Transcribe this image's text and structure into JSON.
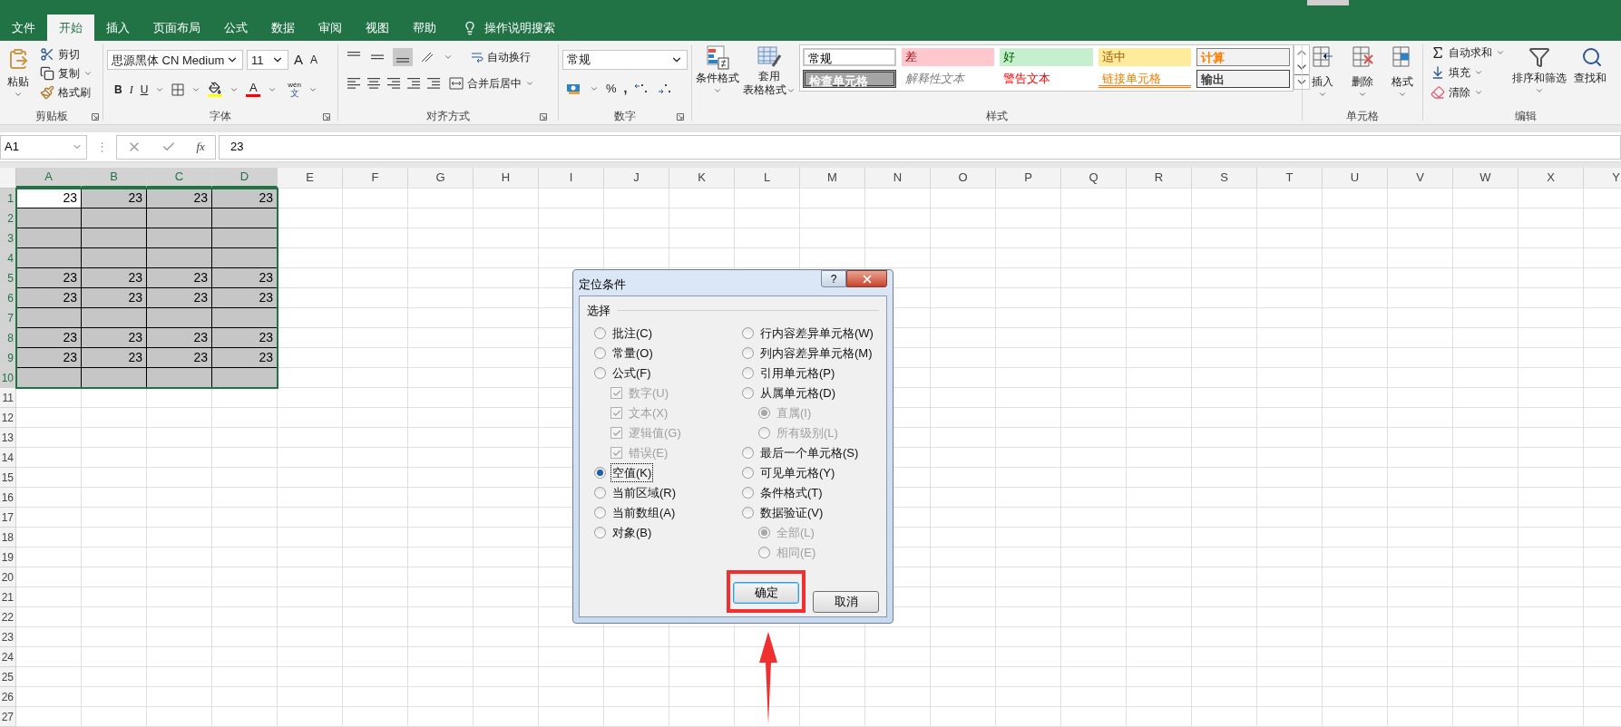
{
  "tabs": [
    {
      "label": "文件",
      "selected": false
    },
    {
      "label": "开始",
      "selected": true
    },
    {
      "label": "插入",
      "selected": false
    },
    {
      "label": "页面布局",
      "selected": false
    },
    {
      "label": "公式",
      "selected": false
    },
    {
      "label": "数据",
      "selected": false
    },
    {
      "label": "审阅",
      "selected": false
    },
    {
      "label": "视图",
      "selected": false
    },
    {
      "label": "帮助",
      "selected": false
    }
  ],
  "tell_me": "操作说明搜索",
  "clipboard": {
    "paste": "粘贴",
    "cut": "剪切",
    "copy": "复制",
    "format_painter": "格式刷",
    "label": "剪贴板"
  },
  "font": {
    "name": "思源黑体 CN Medium",
    "size": "11",
    "grow": "A",
    "shrink": "A",
    "bold": "B",
    "italic": "I",
    "underline": "U",
    "color_glyph": "A",
    "phonetic_top": "wén",
    "phonetic_bottom": "文",
    "label": "字体"
  },
  "alignment": {
    "wrap": "自动换行",
    "merge": "合并后居中",
    "label": "对齐方式"
  },
  "number": {
    "format": "常规",
    "percent": "%",
    "comma": ",",
    "label": "数字"
  },
  "styles": {
    "conditional": "条件格式",
    "table_top": "套用",
    "table_bottom": "表格格式",
    "label": "样式",
    "cells": [
      {
        "label": "常规",
        "kind": "normal"
      },
      {
        "label": "差",
        "kind": "bad"
      },
      {
        "label": "好",
        "kind": "good"
      },
      {
        "label": "适中",
        "kind": "neutral"
      },
      {
        "label": "计算",
        "kind": "calculation"
      },
      {
        "label": "检查单元格",
        "kind": "check"
      },
      {
        "label": "解释性文本",
        "kind": "explanatory"
      },
      {
        "label": "警告文本",
        "kind": "warning"
      },
      {
        "label": "链接单元格",
        "kind": "linked"
      },
      {
        "label": "输出",
        "kind": "output"
      }
    ]
  },
  "cells_group": {
    "insert": "插入",
    "delete": "删除",
    "format": "格式",
    "label": "单元格"
  },
  "editing": {
    "autosum": "自动求和",
    "fill": "填充",
    "clear": "清除",
    "sort": "排序和筛选",
    "find": "查找和",
    "label": "编辑"
  },
  "formula_bar": {
    "name_box": "A1",
    "grip": "⋮",
    "fx": "fx",
    "value": "23"
  },
  "columns": [
    {
      "label": "A",
      "selected": true
    },
    {
      "label": "B",
      "selected": true
    },
    {
      "label": "C",
      "selected": true
    },
    {
      "label": "D",
      "selected": true
    },
    {
      "label": "E",
      "selected": false
    },
    {
      "label": "F",
      "selected": false
    },
    {
      "label": "G",
      "selected": false
    },
    {
      "label": "H",
      "selected": false
    },
    {
      "label": "I",
      "selected": false
    },
    {
      "label": "J",
      "selected": false
    },
    {
      "label": "K",
      "selected": false
    },
    {
      "label": "L",
      "selected": false
    },
    {
      "label": "M",
      "selected": false
    },
    {
      "label": "N",
      "selected": false
    },
    {
      "label": "O",
      "selected": false
    },
    {
      "label": "P",
      "selected": false
    },
    {
      "label": "Q",
      "selected": false
    },
    {
      "label": "R",
      "selected": false
    },
    {
      "label": "S",
      "selected": false
    },
    {
      "label": "T",
      "selected": false
    },
    {
      "label": "U",
      "selected": false
    },
    {
      "label": "V",
      "selected": false
    },
    {
      "label": "W",
      "selected": false
    },
    {
      "label": "X",
      "selected": false
    },
    {
      "label": "Y",
      "selected": false
    }
  ],
  "rows": [
    {
      "label": "1",
      "selected": true,
      "cells": [
        {
          "value": "23",
          "selected": false
        },
        {
          "value": "23",
          "selected": true
        },
        {
          "value": "23",
          "selected": true
        },
        {
          "value": "23",
          "selected": true
        }
      ]
    },
    {
      "label": "2",
      "selected": true,
      "cells": [
        {
          "selected": true
        },
        {
          "selected": true
        },
        {
          "selected": true
        },
        {
          "selected": true
        }
      ]
    },
    {
      "label": "3",
      "selected": true,
      "cells": [
        {
          "selected": true
        },
        {
          "selected": true
        },
        {
          "selected": true
        },
        {
          "selected": true
        }
      ]
    },
    {
      "label": "4",
      "selected": true,
      "cells": [
        {
          "selected": true
        },
        {
          "selected": true
        },
        {
          "selected": true
        },
        {
          "selected": true
        }
      ]
    },
    {
      "label": "5",
      "selected": true,
      "cells": [
        {
          "value": "23",
          "selected": true
        },
        {
          "value": "23",
          "selected": true
        },
        {
          "value": "23",
          "selected": true
        },
        {
          "value": "23",
          "selected": true
        }
      ]
    },
    {
      "label": "6",
      "selected": true,
      "cells": [
        {
          "value": "23",
          "selected": true
        },
        {
          "value": "23",
          "selected": true
        },
        {
          "value": "23",
          "selected": true
        },
        {
          "value": "23",
          "selected": true
        }
      ]
    },
    {
      "label": "7",
      "selected": true,
      "cells": [
        {
          "selected": true
        },
        {
          "selected": true
        },
        {
          "selected": true
        },
        {
          "selected": true
        }
      ]
    },
    {
      "label": "8",
      "selected": true,
      "cells": [
        {
          "value": "23",
          "selected": true
        },
        {
          "value": "23",
          "selected": true
        },
        {
          "value": "23",
          "selected": true
        },
        {
          "value": "23",
          "selected": true
        }
      ]
    },
    {
      "label": "9",
      "selected": true,
      "cells": [
        {
          "value": "23",
          "selected": true
        },
        {
          "value": "23",
          "selected": true
        },
        {
          "value": "23",
          "selected": true
        },
        {
          "value": "23",
          "selected": true
        }
      ]
    },
    {
      "label": "10",
      "selected": true,
      "cells": [
        {
          "selected": true
        },
        {
          "selected": true
        },
        {
          "selected": true
        },
        {
          "selected": true
        }
      ]
    },
    {
      "label": "11",
      "selected": false
    },
    {
      "label": "12",
      "selected": false
    },
    {
      "label": "13",
      "selected": false
    },
    {
      "label": "14",
      "selected": false
    },
    {
      "label": "15",
      "selected": false
    },
    {
      "label": "16",
      "selected": false
    },
    {
      "label": "17",
      "selected": false
    },
    {
      "label": "18",
      "selected": false
    },
    {
      "label": "19",
      "selected": false
    },
    {
      "label": "20",
      "selected": false
    },
    {
      "label": "21",
      "selected": false
    },
    {
      "label": "22",
      "selected": false
    },
    {
      "label": "23",
      "selected": false
    },
    {
      "label": "24",
      "selected": false
    },
    {
      "label": "25",
      "selected": false
    },
    {
      "label": "26",
      "selected": false
    },
    {
      "label": "27",
      "selected": false
    }
  ],
  "dialog": {
    "title": "定位条件",
    "help": "?",
    "group": "选择",
    "columns": [
      {
        "options": [
          {
            "kind": "radio",
            "label": "批注(C)",
            "selected": false,
            "disabled": false
          },
          {
            "kind": "radio",
            "label": "常量(O)",
            "selected": false,
            "disabled": false
          },
          {
            "kind": "radio",
            "label": "公式(F)",
            "selected": false,
            "disabled": false,
            "children": [
              {
                "kind": "checkbox",
                "label": "数字(U)",
                "checked": true,
                "disabled": true
              },
              {
                "kind": "checkbox",
                "label": "文本(X)",
                "checked": true,
                "disabled": true
              },
              {
                "kind": "checkbox",
                "label": "逻辑值(G)",
                "checked": true,
                "disabled": true
              },
              {
                "kind": "checkbox",
                "label": "错误(E)",
                "checked": true,
                "disabled": true
              }
            ]
          },
          {
            "kind": "radio",
            "label": "空值(K)",
            "selected": true,
            "disabled": false,
            "focused": true
          },
          {
            "kind": "radio",
            "label": "当前区域(R)",
            "selected": false,
            "disabled": false
          },
          {
            "kind": "radio",
            "label": "当前数组(A)",
            "selected": false,
            "disabled": false
          },
          {
            "kind": "radio",
            "label": "对象(B)",
            "selected": false,
            "disabled": false
          }
        ]
      },
      {
        "options": [
          {
            "kind": "radio",
            "label": "行内容差异单元格(W)",
            "selected": false,
            "disabled": false
          },
          {
            "kind": "radio",
            "label": "列内容差异单元格(M)",
            "selected": false,
            "disabled": false
          },
          {
            "kind": "radio",
            "label": "引用单元格(P)",
            "selected": false,
            "disabled": false
          },
          {
            "kind": "radio",
            "label": "从属单元格(D)",
            "selected": false,
            "disabled": false,
            "children": [
              {
                "kind": "radio",
                "label": "直属(I)",
                "selected": true,
                "disabled": true
              },
              {
                "kind": "radio",
                "label": "所有级别(L)",
                "selected": false,
                "disabled": true
              }
            ]
          },
          {
            "kind": "radio",
            "label": "最后一个单元格(S)",
            "selected": false,
            "disabled": false
          },
          {
            "kind": "radio",
            "label": "可见单元格(Y)",
            "selected": false,
            "disabled": false
          },
          {
            "kind": "radio",
            "label": "条件格式(T)",
            "selected": false,
            "disabled": false
          },
          {
            "kind": "radio",
            "label": "数据验证(V)",
            "selected": false,
            "disabled": false,
            "children": [
              {
                "kind": "radio",
                "label": "全部(L)",
                "selected": true,
                "disabled": true
              },
              {
                "kind": "radio",
                "label": "相同(E)",
                "selected": false,
                "disabled": true
              }
            ]
          }
        ]
      }
    ],
    "buttons": [
      {
        "label": "确定",
        "default": true,
        "highlighted": true
      },
      {
        "label": "取消",
        "default": false,
        "highlighted": false
      }
    ],
    "arrow": true
  }
}
